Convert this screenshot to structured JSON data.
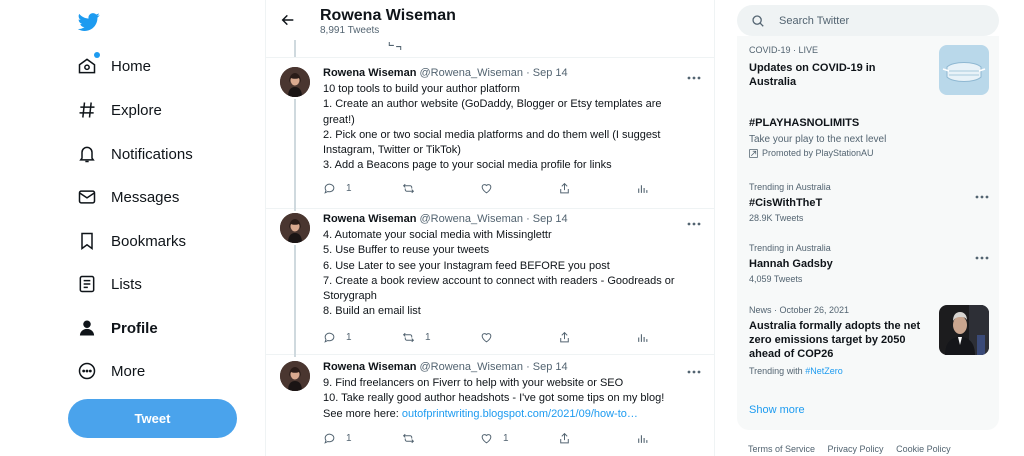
{
  "nav": {
    "items": [
      {
        "label": "Home",
        "icon": "home-icon"
      },
      {
        "label": "Explore",
        "icon": "hashtag-icon"
      },
      {
        "label": "Notifications",
        "icon": "bell-icon"
      },
      {
        "label": "Messages",
        "icon": "envelope-icon"
      },
      {
        "label": "Bookmarks",
        "icon": "bookmark-icon"
      },
      {
        "label": "Lists",
        "icon": "list-icon"
      },
      {
        "label": "Profile",
        "icon": "person-icon"
      },
      {
        "label": "More",
        "icon": "more-circle-icon"
      }
    ],
    "tweet_button": "Tweet"
  },
  "header": {
    "name": "Rowena Wiseman",
    "count": "8,991 Tweets"
  },
  "tweets": [
    {
      "name": "Rowena Wiseman",
      "handle": "@Rowena_Wiseman",
      "sep": "·",
      "date": "Sep 14",
      "lines": [
        "10 top tools to build your author platform",
        "1. Create an author website (GoDaddy, Blogger or Etsy templates are",
        "great!)",
        "2. Pick one or two social media platforms and do them well (I suggest",
        "Instagram, Twitter or TikTok)",
        "3. Add a Beacons page to your social media profile for links"
      ],
      "replies": "1",
      "retweets": "",
      "likes": ""
    },
    {
      "name": "Rowena Wiseman",
      "handle": "@Rowena_Wiseman",
      "sep": "·",
      "date": "Sep 14",
      "lines": [
        "4. Automate your social media with Missinglettr",
        "5. Use Buffer to reuse your tweets",
        "6. Use Later to see your Instagram feed BEFORE you post",
        "7. Create a book review account to connect with readers - Goodreads or",
        "Storygraph",
        "8. Build an email list"
      ],
      "replies": "1",
      "retweets": "1",
      "likes": ""
    },
    {
      "name": "Rowena Wiseman",
      "handle": "@Rowena_Wiseman",
      "sep": "·",
      "date": "Sep 14",
      "lines": [
        "9. Find freelancers on Fiverr to help with your website or SEO",
        "10. Take really good author headshots - I've got some tips on my blog!"
      ],
      "more_here": "See more here: ",
      "link": "outofprintwriting.blogspot.com/2021/09/how-to…",
      "replies": "1",
      "retweets": "",
      "likes": "1"
    }
  ],
  "search": {
    "placeholder": "Search Twitter"
  },
  "trends": [
    {
      "meta": "COVID-19 · LIVE",
      "title_lines": [
        "Updates on COVID-19 in",
        "Australia"
      ]
    },
    {
      "title": "#PLAYHASNOLIMITS",
      "subtitle": "Take your play to the next level",
      "promo": "Promoted by PlayStationAU"
    },
    {
      "meta": "Trending in Australia",
      "title": "#CisWithTheT",
      "count": "28.9K Tweets"
    },
    {
      "meta": "Trending in Australia",
      "title": "Hannah Gadsby",
      "count": "4,059 Tweets"
    },
    {
      "meta": "News · October 26, 2021",
      "title_lines": [
        "Australia formally adopts the net",
        "zero emissions target by 2050",
        "ahead of COP26"
      ],
      "trending_with": "Trending with ",
      "hashtag": "#NetZero"
    }
  ],
  "show_more": "Show more",
  "footer": [
    "Terms of Service",
    "Privacy Policy",
    "Cookie Policy"
  ],
  "colors": {
    "accent": "#1d9bf0",
    "tweet_button": "#4aa3ec",
    "muted": "#536471",
    "panel": "#f7f9f9"
  }
}
